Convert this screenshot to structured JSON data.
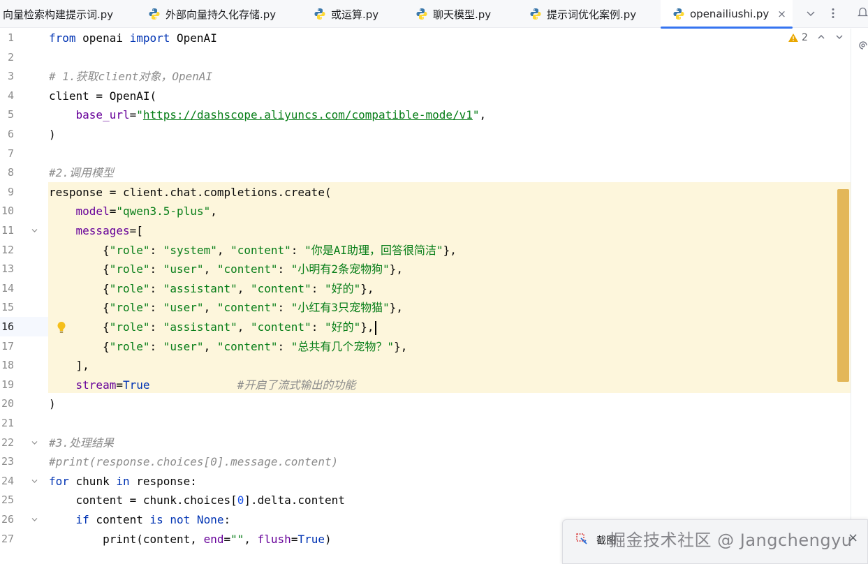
{
  "tabs": [
    {
      "label": "向量检索构建提示词.py",
      "active": false,
      "icon": "python-icon"
    },
    {
      "label": "外部向量持久化存储.py",
      "active": false,
      "icon": "python-icon"
    },
    {
      "label": "或运算.py",
      "active": false,
      "icon": "python-icon"
    },
    {
      "label": "聊天模型.py",
      "active": false,
      "icon": "python-icon"
    },
    {
      "label": "提示词优化案例.py",
      "active": false,
      "icon": "python-icon"
    },
    {
      "label": "openailiushi.py",
      "active": true,
      "icon": "python-icon"
    }
  ],
  "tab_close_glyph": "×",
  "inspections": {
    "warning_count": "2"
  },
  "editor": {
    "current_line": 16,
    "lines": [
      {
        "n": "1"
      },
      {
        "n": "2"
      },
      {
        "n": "3"
      },
      {
        "n": "4"
      },
      {
        "n": "5"
      },
      {
        "n": "6"
      },
      {
        "n": "7"
      },
      {
        "n": "8"
      },
      {
        "n": "9"
      },
      {
        "n": "10"
      },
      {
        "n": "11"
      },
      {
        "n": "12"
      },
      {
        "n": "13"
      },
      {
        "n": "14"
      },
      {
        "n": "15"
      },
      {
        "n": "16"
      },
      {
        "n": "17"
      },
      {
        "n": "18"
      },
      {
        "n": "19"
      },
      {
        "n": "20"
      },
      {
        "n": "21"
      },
      {
        "n": "22"
      },
      {
        "n": "23"
      },
      {
        "n": "24"
      },
      {
        "n": "25"
      },
      {
        "n": "26"
      },
      {
        "n": "27"
      }
    ],
    "code": {
      "l1": [
        [
          "kw",
          "from"
        ],
        [
          "def",
          " openai "
        ],
        [
          "kw",
          "import"
        ],
        [
          "def",
          " OpenAI"
        ]
      ],
      "l2": [],
      "l3": [
        [
          "cm",
          "# 1.获取client对象，OpenAI"
        ]
      ],
      "l4": [
        [
          "def",
          "client = OpenAI("
        ]
      ],
      "l5": [
        [
          "def",
          "    "
        ],
        [
          "param",
          "base_url"
        ],
        [
          "def",
          "="
        ],
        [
          "str",
          "\""
        ],
        [
          "url",
          "https://dashscope.aliyuncs.com/compatible-mode/v1"
        ],
        [
          "str",
          "\""
        ],
        [
          "def",
          ","
        ]
      ],
      "l6": [
        [
          "def",
          ")"
        ]
      ],
      "l7": [],
      "l8": [
        [
          "cm",
          "#2.调用模型"
        ]
      ],
      "l9": [
        [
          "def",
          "response = client.chat.completions.create("
        ]
      ],
      "l10": [
        [
          "def",
          "    "
        ],
        [
          "param",
          "model"
        ],
        [
          "def",
          "="
        ],
        [
          "str",
          "\"qwen3.5-plus\""
        ],
        [
          "def",
          ","
        ]
      ],
      "l11": [
        [
          "def",
          "    "
        ],
        [
          "param",
          "messages"
        ],
        [
          "def",
          "=["
        ]
      ],
      "l12": [
        [
          "def",
          "        {"
        ],
        [
          "str",
          "\"role\""
        ],
        [
          "def",
          ": "
        ],
        [
          "str",
          "\"system\""
        ],
        [
          "def",
          ", "
        ],
        [
          "str",
          "\"content\""
        ],
        [
          "def",
          ": "
        ],
        [
          "str",
          "\"你是AI助理，回答很简洁\""
        ],
        [
          "def",
          "},"
        ]
      ],
      "l13": [
        [
          "def",
          "        {"
        ],
        [
          "str",
          "\"role\""
        ],
        [
          "def",
          ": "
        ],
        [
          "str",
          "\"user\""
        ],
        [
          "def",
          ", "
        ],
        [
          "str",
          "\"content\""
        ],
        [
          "def",
          ": "
        ],
        [
          "str",
          "\"小明有2条宠物狗\""
        ],
        [
          "def",
          "},"
        ]
      ],
      "l14": [
        [
          "def",
          "        {"
        ],
        [
          "str",
          "\"role\""
        ],
        [
          "def",
          ": "
        ],
        [
          "str",
          "\"assistant\""
        ],
        [
          "def",
          ", "
        ],
        [
          "str",
          "\"content\""
        ],
        [
          "def",
          ": "
        ],
        [
          "str",
          "\"好的\""
        ],
        [
          "def",
          "},"
        ]
      ],
      "l15": [
        [
          "def",
          "        {"
        ],
        [
          "str",
          "\"role\""
        ],
        [
          "def",
          ": "
        ],
        [
          "str",
          "\"user\""
        ],
        [
          "def",
          ", "
        ],
        [
          "str",
          "\"content\""
        ],
        [
          "def",
          ": "
        ],
        [
          "str",
          "\"小红有3只宠物猫\""
        ],
        [
          "def",
          "},"
        ]
      ],
      "l16": [
        [
          "def",
          "        {"
        ],
        [
          "str",
          "\"role\""
        ],
        [
          "def",
          ": "
        ],
        [
          "str",
          "\"assistant\""
        ],
        [
          "def",
          ", "
        ],
        [
          "str",
          "\"content\""
        ],
        [
          "def",
          ": "
        ],
        [
          "str",
          "\"好的\""
        ],
        [
          "def",
          "},"
        ]
      ],
      "l17": [
        [
          "def",
          "        {"
        ],
        [
          "str",
          "\"role\""
        ],
        [
          "def",
          ": "
        ],
        [
          "str",
          "\"user\""
        ],
        [
          "def",
          ", "
        ],
        [
          "str",
          "\"content\""
        ],
        [
          "def",
          ": "
        ],
        [
          "str",
          "\"总共有几个宠物？\""
        ],
        [
          "def",
          "},"
        ]
      ],
      "l18": [
        [
          "def",
          "    ],"
        ]
      ],
      "l19": [
        [
          "def",
          "    "
        ],
        [
          "param",
          "stream"
        ],
        [
          "def",
          "="
        ],
        [
          "kw",
          "True"
        ],
        [
          "def",
          "             "
        ],
        [
          "cm",
          "#开启了流式输出的功能"
        ]
      ],
      "l20": [
        [
          "def",
          ")"
        ]
      ],
      "l21": [],
      "l22": [
        [
          "cm",
          "#3.处理结果"
        ]
      ],
      "l23": [
        [
          "cm",
          "#print(response.choices[0].message.content)"
        ]
      ],
      "l24": [
        [
          "kw",
          "for"
        ],
        [
          "def",
          " chunk "
        ],
        [
          "kw",
          "in"
        ],
        [
          "def",
          " response:"
        ]
      ],
      "l25": [
        [
          "def",
          "    content = chunk.choices["
        ],
        [
          "num",
          "0"
        ],
        [
          "def",
          "].delta.content"
        ]
      ],
      "l26": [
        [
          "def",
          "    "
        ],
        [
          "kw",
          "if"
        ],
        [
          "def",
          " content "
        ],
        [
          "kw",
          "is not None"
        ],
        [
          "def",
          ":"
        ]
      ],
      "l27": [
        [
          "def",
          "        print(content, "
        ],
        [
          "param",
          "end"
        ],
        [
          "def",
          "="
        ],
        [
          "str",
          "\"\""
        ],
        [
          "def",
          ", "
        ],
        [
          "param",
          "flush"
        ],
        [
          "def",
          "="
        ],
        [
          "kw",
          "True"
        ],
        [
          "def",
          ")"
        ]
      ]
    }
  },
  "toast": {
    "label": "截图",
    "watermark": "掘金技术社区 @ Jangchengyu"
  }
}
